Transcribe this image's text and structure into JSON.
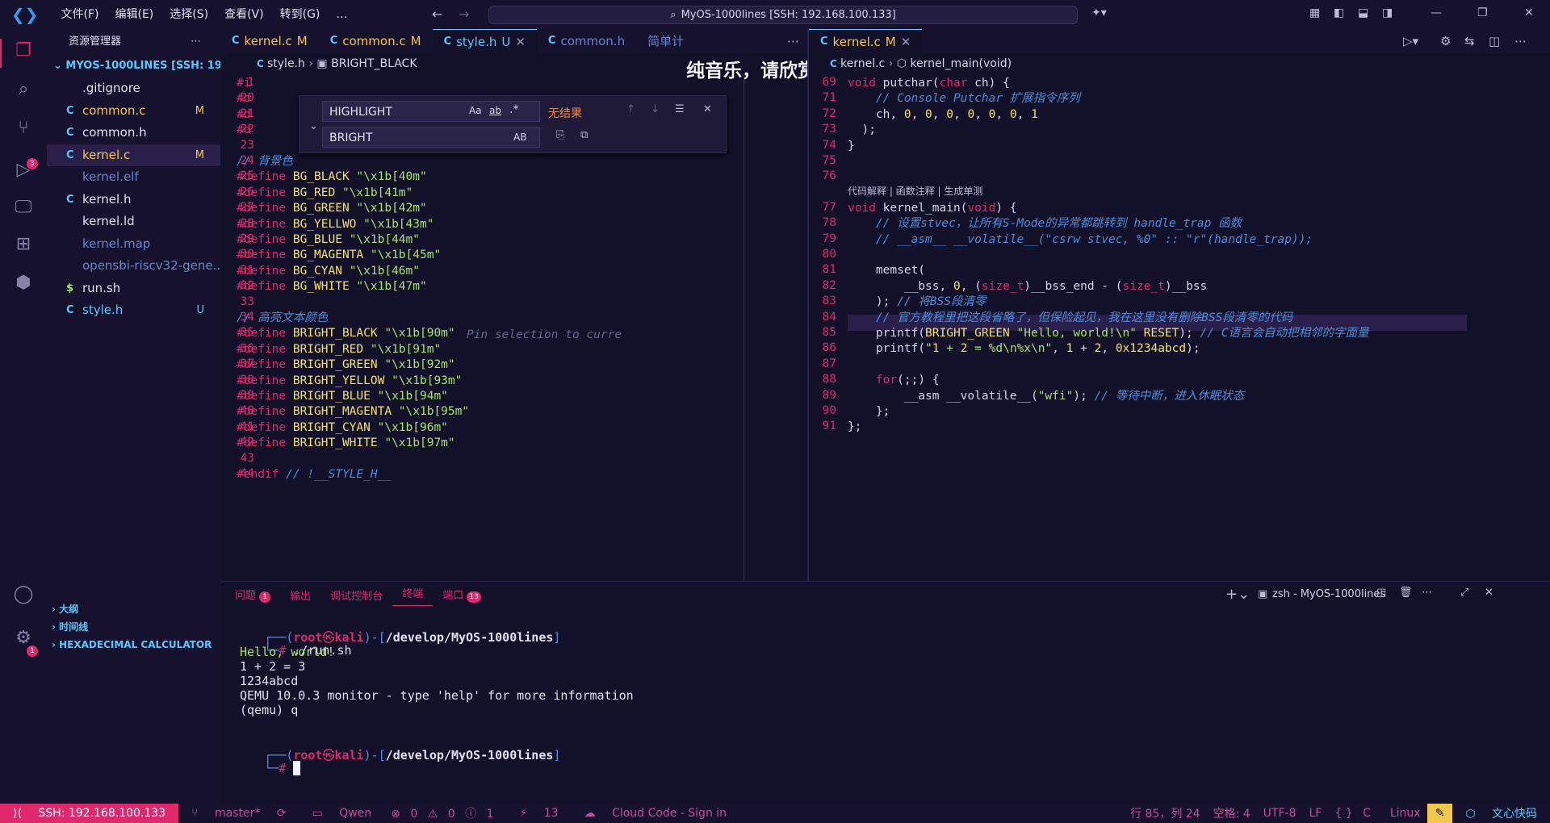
{
  "menu": [
    "文件(F)",
    "编辑(E)",
    "选择(S)",
    "查看(V)",
    "转到(G)",
    "…"
  ],
  "command_center": "MyOS-1000lines [SSH: 192.168.100.133]",
  "overlay_text": "纯音乐，请欣赏",
  "sidebar": {
    "title": "资源管理器",
    "root": "MYOS-1000LINES [SSH: 19...",
    "files": [
      {
        "icon": "",
        "name": ".gitignore",
        "status": "",
        "color": "#e4e0f2"
      },
      {
        "icon": "C",
        "name": "common.c",
        "status": "M",
        "color": "#f3c74a"
      },
      {
        "icon": "C",
        "name": "common.h",
        "status": "",
        "color": "#e4e0f2"
      },
      {
        "icon": "C",
        "name": "kernel.c",
        "status": "M",
        "color": "#f3c74a"
      },
      {
        "icon": "",
        "name": "kernel.elf",
        "status": "",
        "color": "#6a84c8"
      },
      {
        "icon": "C",
        "name": "kernel.h",
        "status": "",
        "color": "#e4e0f2"
      },
      {
        "icon": "",
        "name": "kernel.ld",
        "status": "",
        "color": "#e4e0f2"
      },
      {
        "icon": "",
        "name": "kernel.map",
        "status": "",
        "color": "#6a84c8"
      },
      {
        "icon": "",
        "name": "opensbi-riscv32-gene...",
        "status": "",
        "color": "#6a84c8"
      },
      {
        "icon": "$",
        "name": "run.sh",
        "status": "",
        "color": "#e4e0f2"
      },
      {
        "icon": "C",
        "name": "style.h",
        "status": "U",
        "color": "#5ac8fa"
      }
    ],
    "outline": "大纲",
    "timeline": "时间线",
    "hexcalc": "HEXADECIMAL CALCULATOR"
  },
  "left_tabs": [
    {
      "label": "kernel.c",
      "status": "M"
    },
    {
      "label": "common.c",
      "status": "M"
    },
    {
      "label": "style.h",
      "status": "U"
    },
    {
      "label": "common.h",
      "status": ""
    },
    {
      "label": "简单计",
      "status": ""
    }
  ],
  "left_crumb": {
    "file": "style.h",
    "symbol": "BRIGHT_BLACK"
  },
  "find": {
    "search": "HIGHLIGHT",
    "replace": "BRIGHT",
    "result": "无结果",
    "case": "Aa",
    "word": "ab",
    "regex": ".*",
    "preserve": "AB"
  },
  "left_code": [
    {
      "n": "1",
      "t": "#i"
    },
    {
      "n": "20",
      "t": "#d"
    },
    {
      "n": "21",
      "t": "#d"
    },
    {
      "n": "22",
      "t": "#d"
    },
    {
      "n": "23",
      "t": ""
    },
    {
      "n": "24",
      "t": "// 背景色"
    },
    {
      "n": "25",
      "t": "#define BG_BLACK \"\\x1b[40m\""
    },
    {
      "n": "26",
      "t": "#define BG_RED \"\\x1b[41m\""
    },
    {
      "n": "27",
      "t": "#define BG_GREEN \"\\x1b[42m\""
    },
    {
      "n": "28",
      "t": "#define BG_YELLWO \"\\x1b[43m\""
    },
    {
      "n": "29",
      "t": "#define BG_BLUE \"\\x1b[44m\""
    },
    {
      "n": "30",
      "t": "#define BG_MAGENTA \"\\x1b[45m\""
    },
    {
      "n": "31",
      "t": "#define BG_CYAN \"\\x1b[46m\""
    },
    {
      "n": "32",
      "t": "#define BG_WHITE \"\\x1b[47m\""
    },
    {
      "n": "33",
      "t": ""
    },
    {
      "n": "34",
      "t": "// 高亮文本颜色"
    },
    {
      "n": "35",
      "t": "#define BRIGHT_BLACK \"\\x1b[90m\""
    },
    {
      "n": "36",
      "t": "#define BRIGHT_RED \"\\x1b[91m\""
    },
    {
      "n": "37",
      "t": "#define BRIGHT_GREEN \"\\x1b[92m\""
    },
    {
      "n": "38",
      "t": "#define BRIGHT_YELLOW \"\\x1b[93m\""
    },
    {
      "n": "39",
      "t": "#define BRIGHT_BLUE \"\\x1b[94m\""
    },
    {
      "n": "40",
      "t": "#define BRIGHT_MAGENTA \"\\x1b[95m\""
    },
    {
      "n": "41",
      "t": "#define BRIGHT_CYAN \"\\x1b[96m\""
    },
    {
      "n": "42",
      "t": "#define BRIGHT_WHITE \"\\x1b[97m\""
    },
    {
      "n": "43",
      "t": ""
    },
    {
      "n": "44",
      "t": "#endif // !__STYLE_H__"
    }
  ],
  "pin_hint": "Pin selection to curre",
  "right_tabs": [
    {
      "label": "kernel.c",
      "status": "M"
    }
  ],
  "right_crumb": {
    "file": "kernel.c",
    "symbol": "kernel_main(void)"
  },
  "codelens": "代码解释 | 函数注释 | 生成单测",
  "right_code": [
    {
      "n": "69",
      "t": "void putchar(char ch) {"
    },
    {
      "n": "71",
      "t": "    // Console Putchar 扩展指令序列"
    },
    {
      "n": "72",
      "t": "    ch, 0, 0, 0, 0, 0, 0, 1"
    },
    {
      "n": "73",
      "t": "  );"
    },
    {
      "n": "74",
      "t": "}"
    },
    {
      "n": "75",
      "t": ""
    },
    {
      "n": "76",
      "t": ""
    },
    {
      "n": "77",
      "t": "void kernel_main(void) {"
    },
    {
      "n": "78",
      "t": "    // 设置stvec，让所有S-Mode的异常都跳转到 handle_trap 函数"
    },
    {
      "n": "79",
      "t": "    // __asm__ __volatile__(\"csrw stvec, %0\" :: \"r\"(handle_trap));"
    },
    {
      "n": "80",
      "t": ""
    },
    {
      "n": "81",
      "t": "    memset("
    },
    {
      "n": "82",
      "t": "        __bss, 0, (size_t)__bss_end - (size_t)__bss"
    },
    {
      "n": "83",
      "t": "    ); // 将BSS段清零"
    },
    {
      "n": "84",
      "t": "    // 官方教程里把这段省略了，但保险起见，我在这里没有删除BSS段清零的代码"
    },
    {
      "n": "85",
      "t": "    printf(BRIGHT_GREEN \"Hello, world!\\n\" RESET); // C语言会自动把相邻的字面量"
    },
    {
      "n": "86",
      "t": "    printf(\"1 + 2 = %d\\n%x\\n\", 1 + 2, 0x1234abcd);"
    },
    {
      "n": "87",
      "t": ""
    },
    {
      "n": "88",
      "t": "    for(;;) {"
    },
    {
      "n": "89",
      "t": "        __asm __volatile__(\"wfi\"); // 等待中断，进入休眠状态"
    },
    {
      "n": "90",
      "t": "    };"
    },
    {
      "n": "91",
      "t": "};"
    }
  ],
  "panel": {
    "tabs": [
      {
        "label": "问题",
        "badge": "1"
      },
      {
        "label": "输出",
        "badge": ""
      },
      {
        "label": "调试控制台",
        "badge": ""
      },
      {
        "label": "终端",
        "badge": ""
      },
      {
        "label": "端口",
        "badge": "13"
      }
    ],
    "terminal_name": "zsh - MyOS-1000lines",
    "prompt_user": "root",
    "prompt_host": "kali",
    "prompt_path": "/develop/MyOS-1000lines",
    "command": "./run.sh",
    "output": [
      "Hello, world!",
      "1 + 2 = 3",
      "1234abcd",
      "QEMU 10.0.3 monitor - type 'help' for more information",
      "(qemu) q"
    ]
  },
  "status": {
    "remote": "SSH: 192.168.100.133",
    "branch": "master*",
    "qwen": "Qwen",
    "problems": "0",
    "warnings": "0",
    "info": "1",
    "ports": "13",
    "cloud": "Cloud Code - Sign in",
    "position": "行 85，列 24",
    "spaces": "空格: 4",
    "encoding": "UTF-8",
    "eol": "LF",
    "lang": "C",
    "os": "Linux",
    "wenxin": "文心快码"
  }
}
